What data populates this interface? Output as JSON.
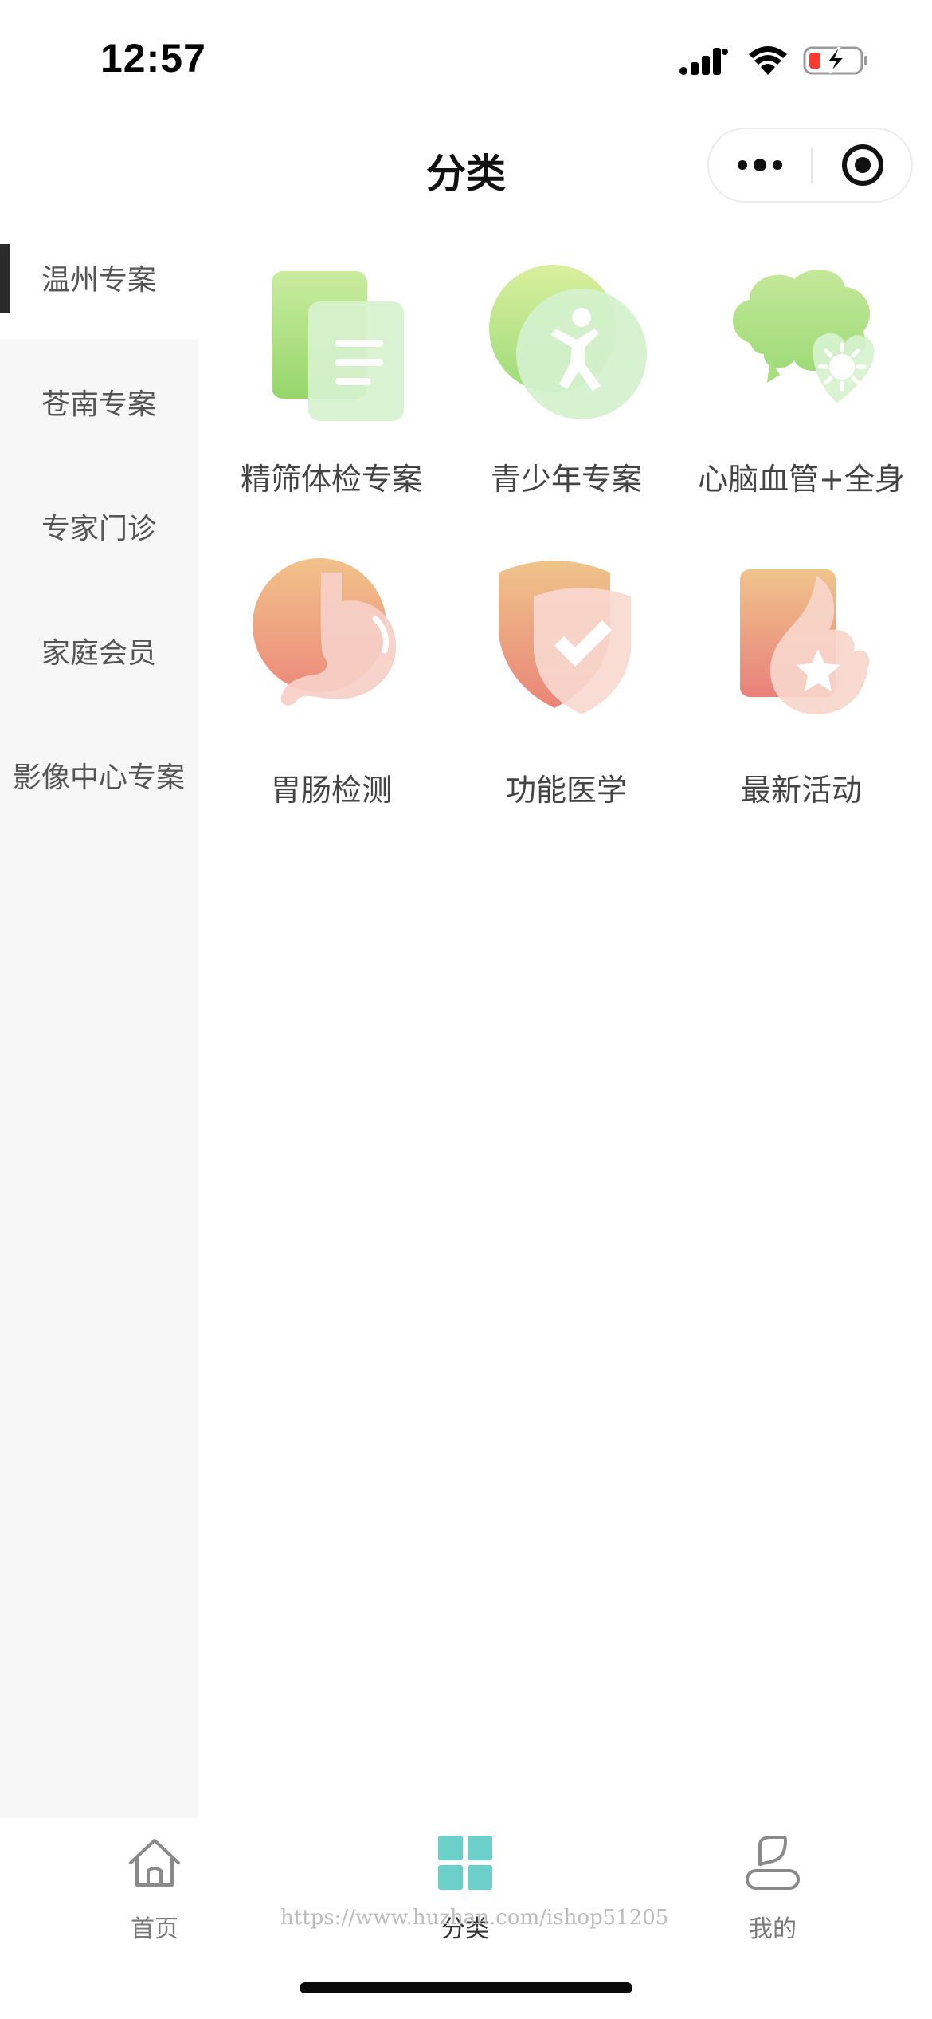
{
  "status_bar": {
    "time": "12:57"
  },
  "header": {
    "title": "分类"
  },
  "sidebar": {
    "items": [
      {
        "label": "温州专案",
        "active": true
      },
      {
        "label": "苍南专案",
        "active": false
      },
      {
        "label": "专家门诊",
        "active": false
      },
      {
        "label": "家庭会员",
        "active": false
      },
      {
        "label": "影像中心专案",
        "active": false
      }
    ]
  },
  "grid": {
    "items": [
      {
        "label": "精筛体检专案",
        "icon": "document-icon"
      },
      {
        "label": "青少年专案",
        "icon": "youth-icon"
      },
      {
        "label": "心脑血管+全身",
        "icon": "brain-heart-icon"
      },
      {
        "label": "胃肠检测",
        "icon": "stomach-icon"
      },
      {
        "label": "功能医学",
        "icon": "shield-check-icon"
      },
      {
        "label": "最新活动",
        "icon": "star-card-icon"
      }
    ]
  },
  "tabbar": {
    "items": [
      {
        "label": "首页",
        "icon": "home-icon",
        "active": false
      },
      {
        "label": "分类",
        "icon": "category-grid-icon",
        "active": true
      },
      {
        "label": "我的",
        "icon": "user-icon",
        "active": false
      }
    ]
  },
  "watermark": "https://www.huzhan.com/ishop51205",
  "colors": {
    "accent": "#6ccfc9",
    "green": "#a8df7e",
    "coral": "#ec8f7c"
  }
}
